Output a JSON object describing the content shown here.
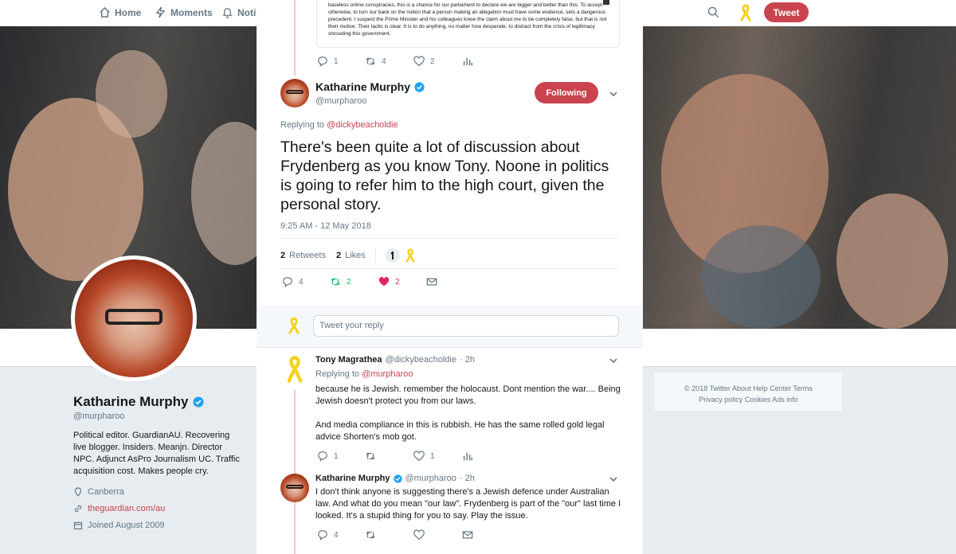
{
  "nav": {
    "home_label": "Home",
    "moments_label": "Moments",
    "notifications_label": "Notif",
    "tweet_button": "Tweet"
  },
  "profile": {
    "name": "Katharine Murphy",
    "handle": "@murpharoo",
    "bio": "Political editor. GuardianAU. Recovering live blogger. Insiders. Meanjn. Director NPC. Adjunct AsPro Journalism UC. Traffic acquisition cost. Makes people cry.",
    "location": "Canberra",
    "url": "theguardian.com/au",
    "joined": "Joined August 2009"
  },
  "footer": {
    "line1": "© 2018 Twitter   About   Help Center   Terms",
    "line2": "Privacy policy   Cookies   Ads info"
  },
  "quoted_tweet": {
    "text": "baseless online conspiracies, this is a chance for our parliament to declare we are bigger and better than this. To accept otherwise, to turn our back on the notion that a person making an allegation must have some evidence, sets a dangerous precedent. I suspect the Prime Minister and his colleagues knew the claim about me to be completely false, but that is not their motive. Their tactic is clear. It is to do anything, no matter how desperate, to distract from the crisis of legitimacy shrouding this government.",
    "replies": "1",
    "retweets": "4",
    "likes": "2"
  },
  "main_tweet": {
    "author_name": "Katharine Murphy",
    "author_handle": "@murpharoo",
    "follow_label": "Following",
    "replying_prefix": "Replying to",
    "replying_to": "@dickybeacholdie",
    "text": "There's been quite a lot of discussion about Frydenberg as you know Tony. Noone in politics is going to refer him to the high court, given the personal story.",
    "timestamp": "9:25 AM - 12 May 2018",
    "retweets_count": "2",
    "retweets_label": "Retweets",
    "likes_count": "2",
    "likes_label": "Likes",
    "replies": "4",
    "retweets": "2",
    "likes": "2"
  },
  "reply_box": {
    "placeholder": "Tweet your reply"
  },
  "replies": [
    {
      "author_name": "Tony Magrathea",
      "author_handle": "@dickybeacholdie",
      "time": "· 2h",
      "replying_prefix": "Replying to",
      "replying_to": "@murpharoo",
      "text1": "because he is Jewish. remember the holocaust.  Dont mention the war....  Being Jewish doesn't protect you from our laws.",
      "text2": "And media compliance in this is rubbish.  He has the same rolled gold legal advice Shorten's mob got.",
      "replies": "1",
      "likes": "1"
    },
    {
      "author_name": "Katharine Murphy",
      "author_handle": "@murpharoo",
      "time": "· 2h",
      "text": "I don't think anyone is suggesting there's a Jewish defence under Australian law. And what do you mean \"our law\". Frydenberg is part of the \"our\" last time I looked. It's a stupid thing for you to say. Play the issue.",
      "replies": "4"
    }
  ],
  "colors": {
    "accent": "#c9444f",
    "verified": "#1da1f2",
    "retweet_green": "#17bf63",
    "like_red": "#e0245e",
    "ribbon_yellow": "#f5d21a"
  }
}
